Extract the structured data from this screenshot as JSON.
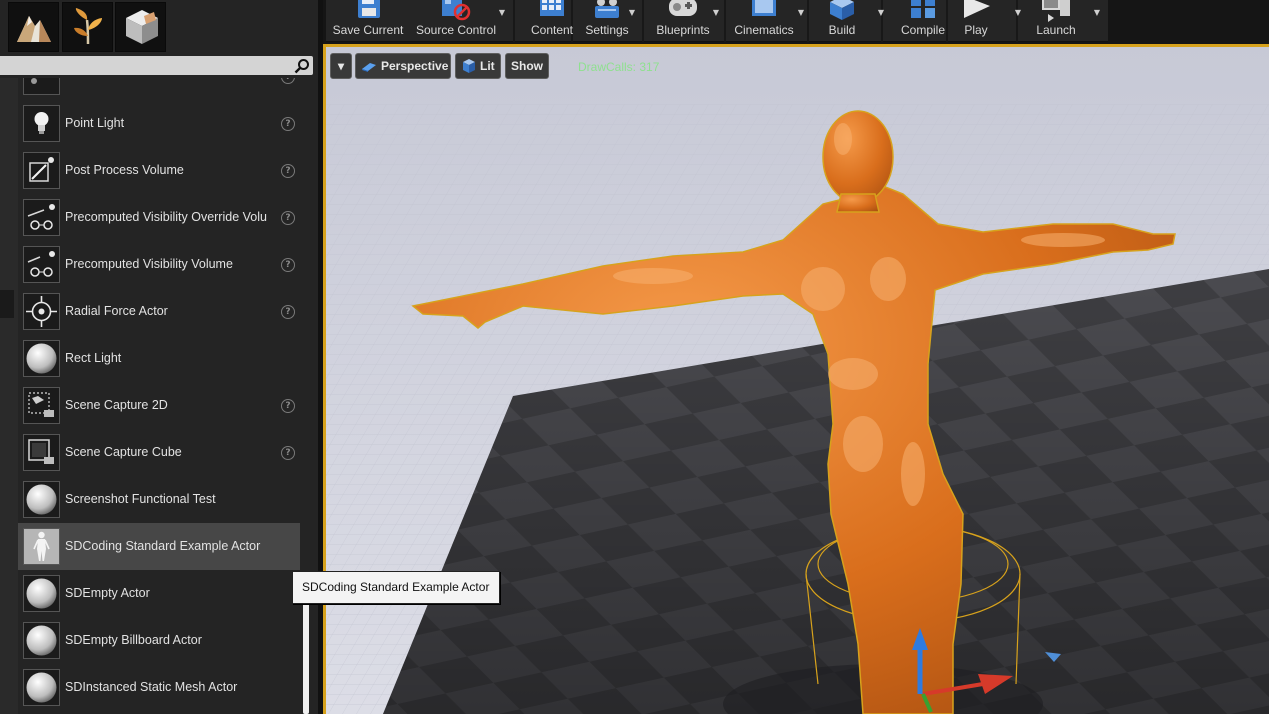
{
  "modes": [
    {
      "icon": "place-mode-icon"
    },
    {
      "icon": "foliage-mode-icon"
    },
    {
      "icon": "geometry-mode-icon"
    }
  ],
  "search": {
    "value": "",
    "placeholder": ""
  },
  "actor_list": {
    "items": [
      {
        "label": "",
        "icon": "partial-item-icon",
        "help": true
      },
      {
        "label": "Point Light",
        "icon": "point-light-icon",
        "help": true
      },
      {
        "label": "Post Process Volume",
        "icon": "post-process-volume-icon",
        "help": true
      },
      {
        "label": "Precomputed Visibility Override Volu",
        "icon": "visibility-override-icon",
        "help": true
      },
      {
        "label": "Precomputed Visibility Volume",
        "icon": "visibility-volume-icon",
        "help": true
      },
      {
        "label": "Radial Force Actor",
        "icon": "radial-force-icon",
        "help": true
      },
      {
        "label": "Rect Light",
        "icon": "sphere-icon",
        "help": false
      },
      {
        "label": "Scene Capture 2D",
        "icon": "scene-capture-2d-icon",
        "help": true
      },
      {
        "label": "Scene Capture Cube",
        "icon": "scene-capture-cube-icon",
        "help": true
      },
      {
        "label": "Screenshot Functional Test",
        "icon": "sphere-icon",
        "help": false
      },
      {
        "label": "SDCoding Standard Example Actor",
        "icon": "mannequin-icon",
        "help": false,
        "selected": true
      },
      {
        "label": "SDEmpty Actor",
        "icon": "sphere-icon",
        "help": false
      },
      {
        "label": "SDEmpty Billboard Actor",
        "icon": "sphere-icon",
        "help": false
      },
      {
        "label": "SDInstanced Static Mesh Actor",
        "icon": "sphere-icon",
        "help": false
      }
    ],
    "help_glyph": "?"
  },
  "toolbar": {
    "buttons": [
      {
        "label": "Save Current",
        "icon": "save-icon",
        "dropdown": false
      },
      {
        "label": "Source Control",
        "icon": "source-control-icon",
        "dropdown": true
      },
      {
        "label": "Content",
        "icon": "content-icon",
        "dropdown": false
      },
      {
        "label": "Settings",
        "icon": "settings-icon",
        "dropdown": true
      },
      {
        "label": "Blueprints",
        "icon": "blueprints-icon",
        "dropdown": true
      },
      {
        "label": "Cinematics",
        "icon": "cinematics-icon",
        "dropdown": true
      },
      {
        "label": "Build",
        "icon": "build-icon",
        "dropdown": true
      },
      {
        "label": "Compile",
        "icon": "compile-icon",
        "dropdown": false
      },
      {
        "label": "Play",
        "icon": "play-icon",
        "dropdown": true
      },
      {
        "label": "Launch",
        "icon": "launch-icon",
        "dropdown": true
      }
    ],
    "dropdown_glyph": "▼"
  },
  "viewport": {
    "menu_glyph": "▾",
    "perspective_label": "Perspective",
    "lit_label": "Lit",
    "show_label": "Show",
    "drawcalls": "DrawCalls: 317"
  },
  "tooltip": {
    "text": "SDCoding Standard Example Actor"
  },
  "colors": {
    "selection_outline": "#d7a21c",
    "mannequin": "#d96e1c",
    "drawcalls_text": "#8fe08f",
    "gizmo_up": "#2e7be0",
    "gizmo_x": "#d63a2a",
    "gizmo_y": "#3aa030"
  }
}
